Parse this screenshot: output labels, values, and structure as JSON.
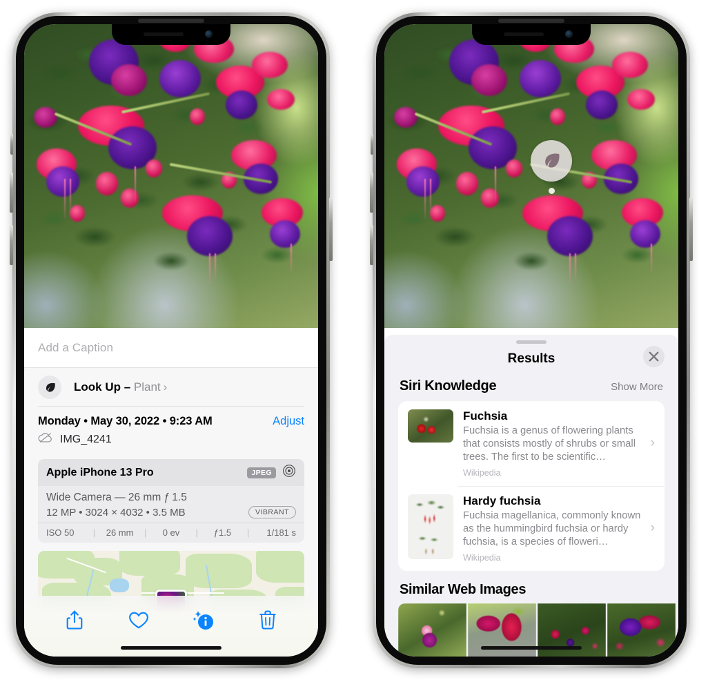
{
  "left_phone": {
    "caption": {
      "placeholder": "Add a Caption",
      "value": ""
    },
    "lookup": {
      "label": "Look Up –",
      "subject": "Plant",
      "chevron": "›",
      "icon": "leaf-icon"
    },
    "meta": {
      "date": "Monday • May 30, 2022 • 9:23 AM",
      "adjust_label": "Adjust",
      "filename": "IMG_4241",
      "cloud_icon": "cloud-slash-icon"
    },
    "exif": {
      "device": "Apple iPhone 13 Pro",
      "format_tag": "JPEG",
      "lens_icon": "camera-lens-icon",
      "lens_line": "Wide Camera — 26 mm ƒ 1.5",
      "size_line": "12 MP • 3024 × 4032 • 3.5 MB",
      "style_tag": "VIBRANT",
      "stats": [
        "ISO 50",
        "26 mm",
        "0 ev",
        "ƒ1.5",
        "1/181 s"
      ]
    },
    "toolbar": [
      {
        "name": "share-icon",
        "label": "Share"
      },
      {
        "name": "heart-icon",
        "label": "Favorite"
      },
      {
        "name": "info-sparkle-icon",
        "label": "Info"
      },
      {
        "name": "trash-icon",
        "label": "Delete"
      }
    ]
  },
  "right_phone": {
    "pin": {
      "icon": "leaf-icon"
    },
    "sheet": {
      "title": "Results",
      "close_label": "✕",
      "close_icon": "close-icon"
    },
    "siri_knowledge": {
      "heading": "Siri Knowledge",
      "action": "Show More",
      "items": [
        {
          "title": "Fuchsia",
          "description": "Fuchsia is a genus of flowering plants that consists mostly of shrubs or small trees. The first to be scientific…",
          "source": "Wikipedia",
          "chevron": "›"
        },
        {
          "title": "Hardy fuchsia",
          "description": "Fuchsia magellanica, commonly known as the hummingbird fuchsia or hardy fuchsia, is a species of floweri…",
          "source": "Wikipedia",
          "chevron": "›"
        }
      ]
    },
    "similar_web_images": {
      "heading": "Similar Web Images",
      "count": 4
    }
  },
  "colors": {
    "accent_blue": "#0a84ff",
    "sheet_bg": "#f2f2f6",
    "card_bg": "#ffffff",
    "secondary_text": "#8a8a8f",
    "tag_gray": "#9a9aa0"
  }
}
